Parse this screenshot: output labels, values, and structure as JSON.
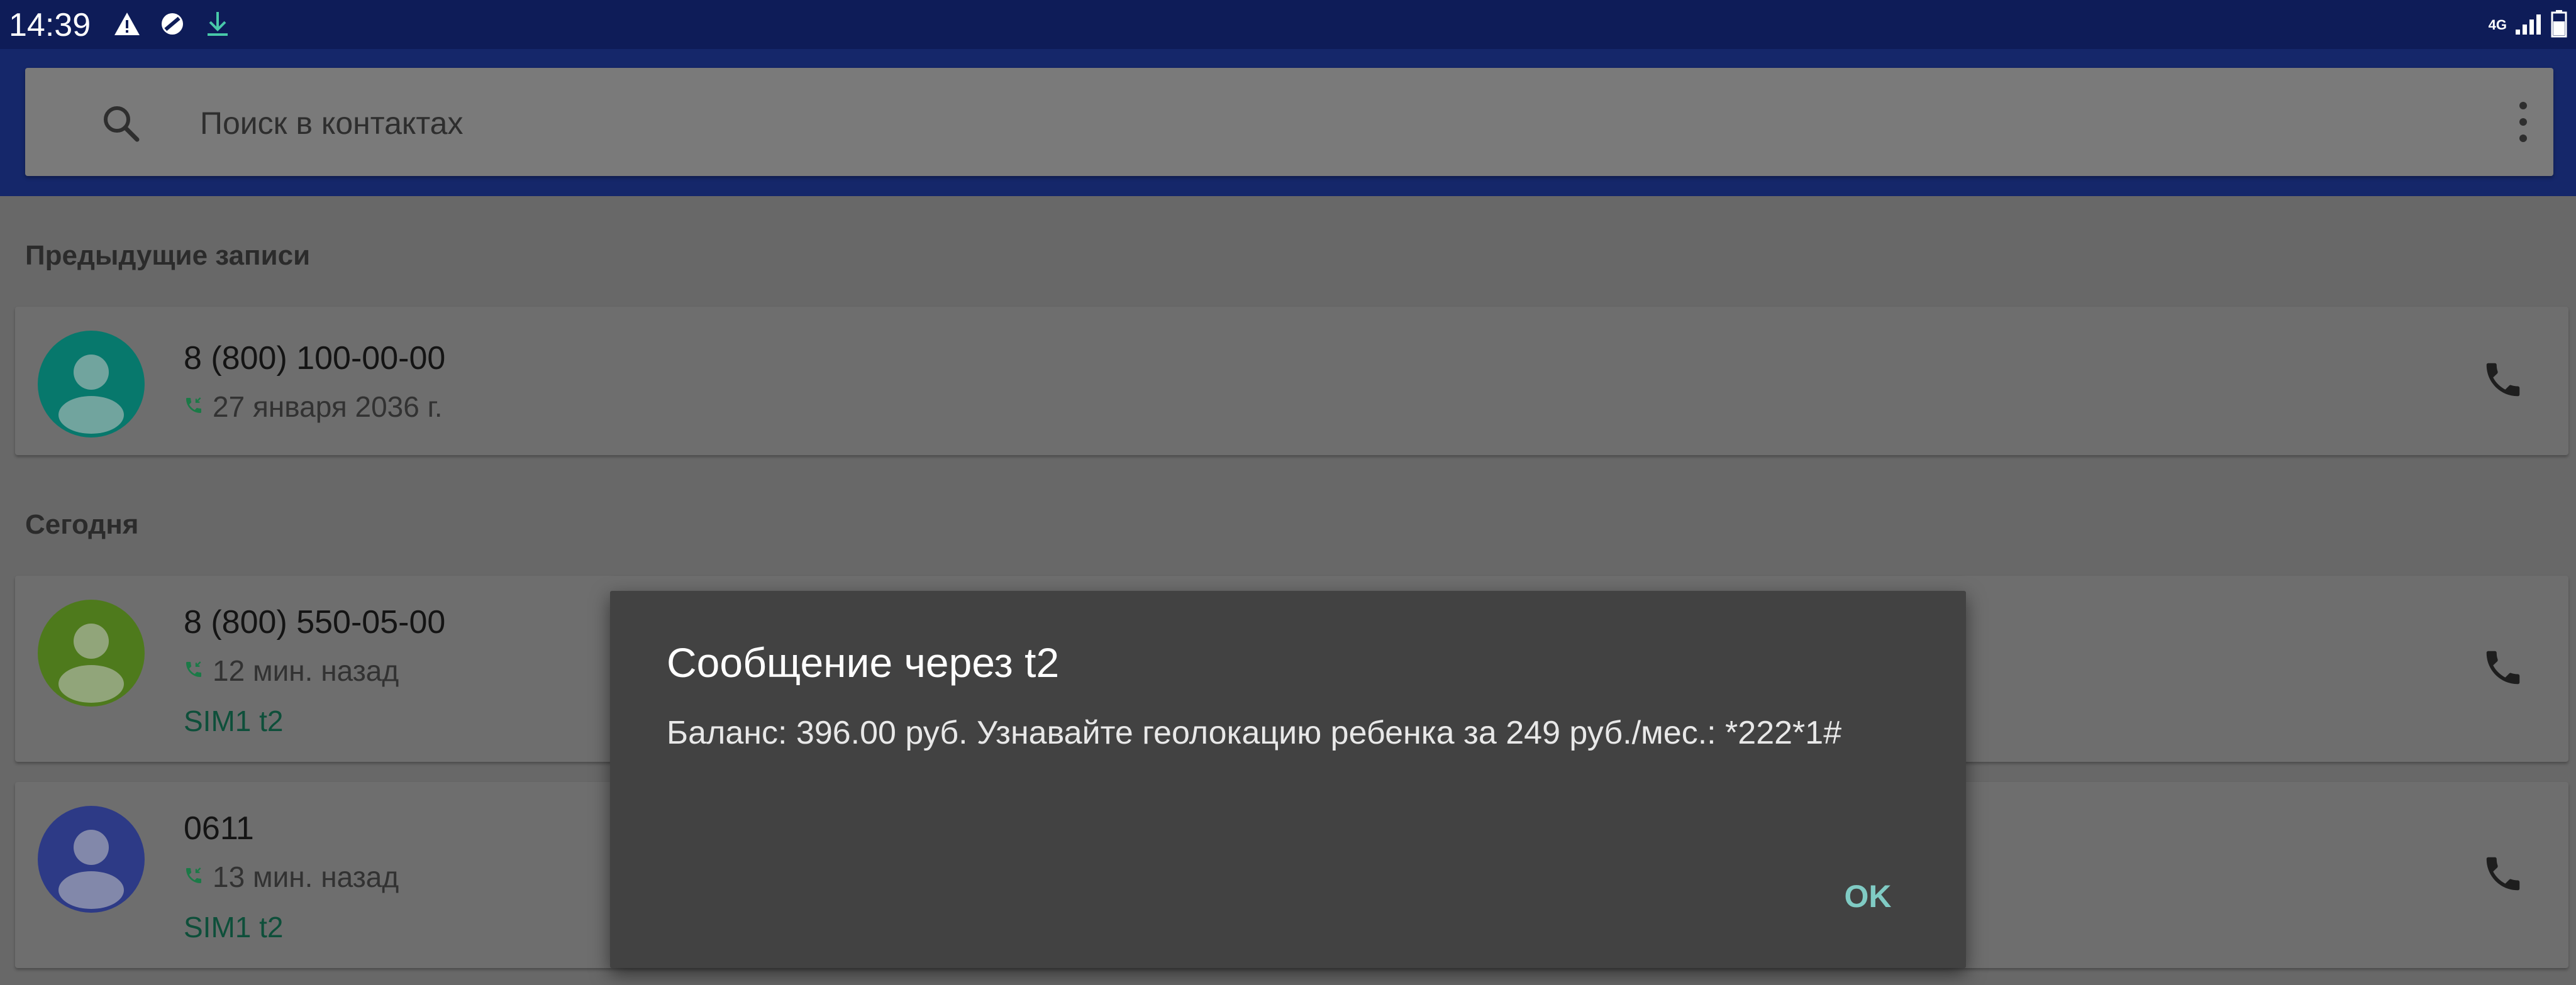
{
  "status_bar": {
    "time": "14:39",
    "network": "4G",
    "left_icons": [
      "warning-icon",
      "blocked-icon",
      "download-icon"
    ],
    "right_icons": [
      "signal-icon",
      "battery-icon"
    ]
  },
  "search": {
    "placeholder": "Поиск в контактах",
    "value": ""
  },
  "sections": {
    "previous": "Предыдущие записи",
    "today": "Сегодня"
  },
  "calls": [
    {
      "number": "8 (800) 100-00-00",
      "time": "27 января 2036 г.",
      "sim": "",
      "avatar_color": "#07786c"
    },
    {
      "number": "8 (800) 550-05-00",
      "time": "12 мин. назад",
      "sim": "SIM1 t2",
      "avatar_color": "#4e7a1c"
    },
    {
      "number": "0611",
      "time": "13 мин. назад",
      "sim": "SIM1 t2",
      "avatar_color": "#2d3a86"
    }
  ],
  "dialog": {
    "title": "Сообщение через t2",
    "body": "Баланс: 396.00 руб. Узнавайте геолокацию ребенка за 249 руб./мес.: *222*1#",
    "ok_label": "OK"
  },
  "colors": {
    "status_bar": "#0e1c58",
    "app_bar": "#15276a",
    "incoming_call_icon": "#1b7a47",
    "dialog_bg": "#424242",
    "dialog_button": "#80cbc4"
  }
}
